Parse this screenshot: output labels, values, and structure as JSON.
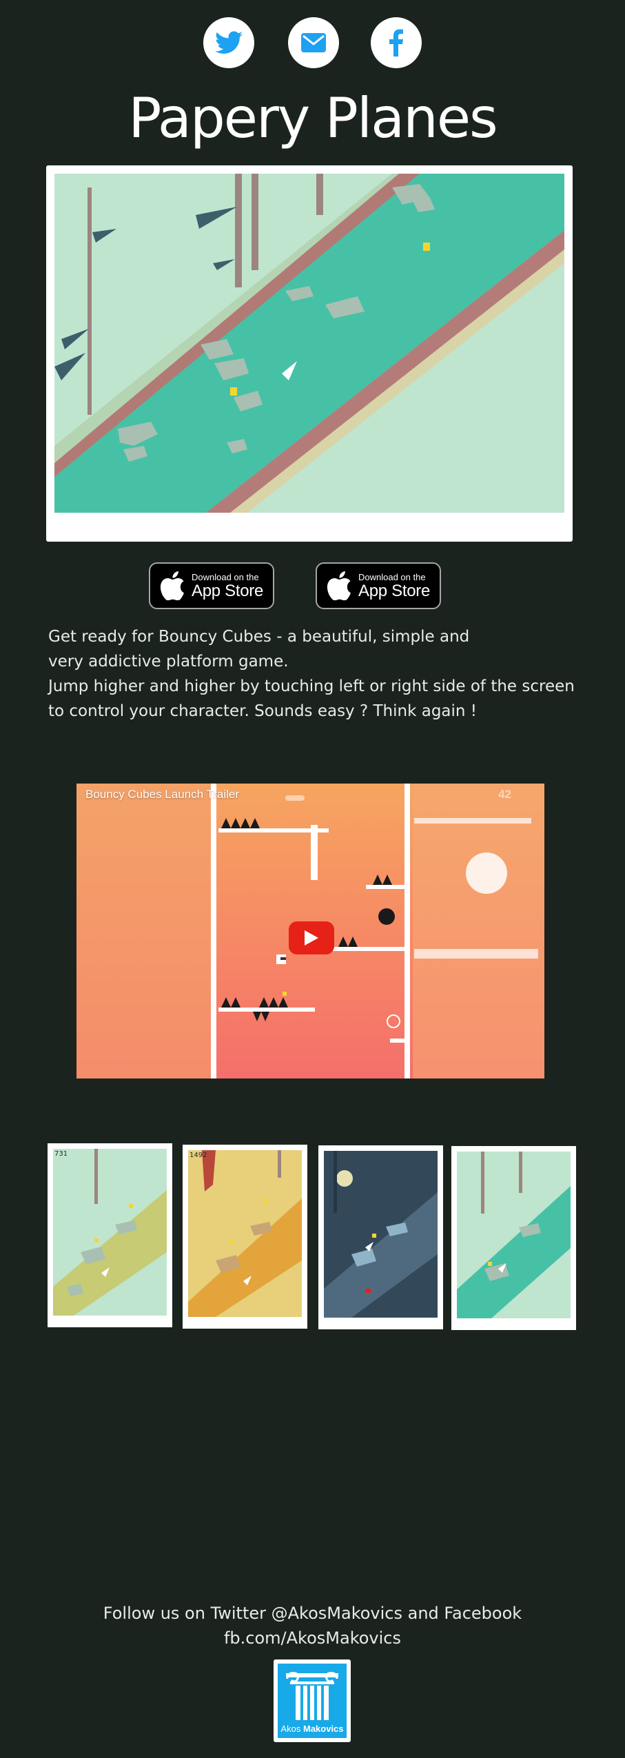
{
  "social": {
    "twitter": "twitter-icon",
    "email": "mail-icon",
    "facebook": "facebook-icon",
    "icon_color": "#1da1f2"
  },
  "page_title": "Papery Planes",
  "store_buttons": [
    {
      "small": "Download on the",
      "big": "App Store"
    },
    {
      "small": "Download on the",
      "big": "App Store"
    }
  ],
  "description": {
    "line1": "Get ready for Bouncy Cubes - a beautiful, simple and",
    "line2": "very addictive platform game.",
    "line3": "Jump higher and higher by touching left or right side of the screen",
    "line4": "to control your character. Sounds easy ? Think again !"
  },
  "video": {
    "title": "Bouncy Cubes Launch Trailer",
    "score": "42"
  },
  "screenshots": {
    "scores": [
      "731",
      "1492",
      "",
      ""
    ]
  },
  "footer": {
    "line1": "Follow us on Twitter @AkosMakovics and Facebook",
    "line2": "fb.com/AkosMakovics",
    "logo_first": "Akos",
    "logo_last": "Makovics"
  },
  "colors": {
    "background": "#1b231e",
    "river": "#46c1a6",
    "land": "#bfe5cf",
    "logo_blue": "#18a9e8",
    "play_red": "#e62117"
  }
}
